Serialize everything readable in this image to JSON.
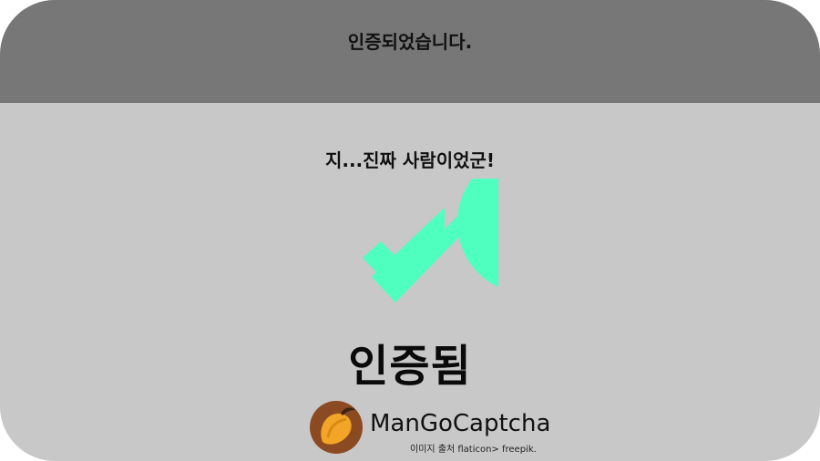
{
  "header": {
    "title": "인증되었습니다."
  },
  "main": {
    "subtitle": "지...진짜 사람이었군!",
    "check_icon": "check-circle-icon",
    "status_label": "인증됨"
  },
  "brand": {
    "logo_icon": "mango-logo-icon",
    "name": "ManGoCaptcha",
    "credit": "이미지 출처 flaticon> freepik."
  },
  "colors": {
    "header_bg": "#777777",
    "panel_bg": "#c8c8c8",
    "check": "#4effc0",
    "logo_circle": "#8c4a22",
    "mango": "#f2a527",
    "leaf": "#3b2410"
  }
}
